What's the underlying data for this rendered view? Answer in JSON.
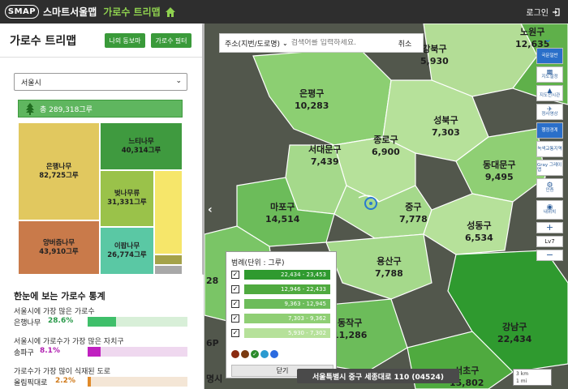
{
  "topbar": {
    "logo_text": "SMAP",
    "app_name": "스마트서울맵",
    "section": "가로수 트리맵",
    "login": "로그인"
  },
  "panel": {
    "title": "가로수 트리맵",
    "btn_my": "나의 동보마",
    "btn_filter": "가로수 필터",
    "region_select": "서울시",
    "total": "총 289,318그루"
  },
  "treemap": [
    {
      "name": "은행나무",
      "count": "82,725그루",
      "color": "#e1c85f"
    },
    {
      "name": "양버즘나무",
      "count": "43,910그루",
      "color": "#c97a4a"
    },
    {
      "name": "느티나무",
      "count": "40,314그루",
      "color": "#3f9a3f"
    },
    {
      "name": "벚나무류",
      "count": "31,331그루",
      "color": "#9ac24a"
    },
    {
      "name": "이팝나무",
      "count": "26,774그루",
      "color": "#5ac8a4"
    },
    {
      "name": "",
      "count": "",
      "color": "#f6e66a"
    },
    {
      "name": "",
      "count": "",
      "color": "#a4a24a"
    },
    {
      "name": "",
      "count": "",
      "color": "#a8a8a8"
    }
  ],
  "stats": {
    "title": "한눈에 보는 가로수 통계",
    "items": [
      {
        "question": "서울시에 가장 많은 가로수",
        "name": "은행나무",
        "pct": "28.6%",
        "pct_value": 28.6,
        "color": "#3fbf6a",
        "track": "#d8efd8"
      },
      {
        "question": "서울시에 가로수가 가장 많은 자치구",
        "name": "송파구",
        "pct": "8.1%",
        "pct_value": 8.1,
        "color": "#c020c0",
        "track": "#efd8ef"
      },
      {
        "question": "가로수가 가장 많이 식재된 도로",
        "name": "올림픽대로",
        "pct": "2.2%",
        "pct_value": 2.2,
        "color": "#e08a2a",
        "track": "#f4e6d6"
      }
    ]
  },
  "search": {
    "type": "주소(지번/도로명)",
    "placeholder": "검색어를 입력하세요.",
    "cancel": "취소"
  },
  "districts": [
    {
      "name": "노원구",
      "count": "12,635"
    },
    {
      "name": "강북구",
      "count": "5,930"
    },
    {
      "name": "은평구",
      "count": "10,283"
    },
    {
      "name": "성북구",
      "count": "7,303"
    },
    {
      "name": "종로구",
      "count": "6,900"
    },
    {
      "name": "서대문구",
      "count": "7,439"
    },
    {
      "name": "동대문구",
      "count": "9,495"
    },
    {
      "name": "마포구",
      "count": "14,514"
    },
    {
      "name": "중구",
      "count": "7,778"
    },
    {
      "name": "성동구",
      "count": "6,534"
    },
    {
      "name": "용산구",
      "count": "7,788"
    },
    {
      "name": "동작구",
      "count": "11,286"
    },
    {
      "name": "강남구",
      "count": "22,434"
    },
    {
      "name": "서초구",
      "count": "15,802"
    },
    {
      "name": "",
      "count": "28"
    },
    {
      "name": "6P",
      "count": ""
    },
    {
      "name": "명시",
      "count": ""
    }
  ],
  "tools": [
    {
      "label": "국문일반"
    },
    {
      "label": "지도설정"
    },
    {
      "label": "지도전시관"
    },
    {
      "label": "정사영상"
    },
    {
      "label": "행정경계"
    },
    {
      "label": "녹색교통지역"
    },
    {
      "label": "Gray 그레이맵"
    },
    {
      "label": "인증"
    },
    {
      "label": "내위치"
    },
    {
      "label": "+"
    },
    {
      "label": "Lv7"
    },
    {
      "label": "−"
    }
  ],
  "legend": {
    "title": "범례(단위 : 그루)",
    "ranges": [
      {
        "label": "22,434 - 23,453",
        "color": "#2f9a2f"
      },
      {
        "label": "12,946 - 22,433",
        "color": "#4faa3f"
      },
      {
        "label": "9,363 - 12,945",
        "color": "#6cbc5a"
      },
      {
        "label": "7,303 - 9,362",
        "color": "#8fcf74"
      },
      {
        "label": "5,930 - 7,302",
        "color": "#b6e19a"
      }
    ],
    "dots": [
      "#8a2a10",
      "#7a3a10",
      "#2a8a2a",
      "#2a9ad0",
      "#2a6ae0"
    ],
    "close": "닫기"
  },
  "address_bar": "서울특별시 중구 세종대로 110 (04524)",
  "scale": {
    "km": "3 km",
    "mi": "1 mi"
  }
}
